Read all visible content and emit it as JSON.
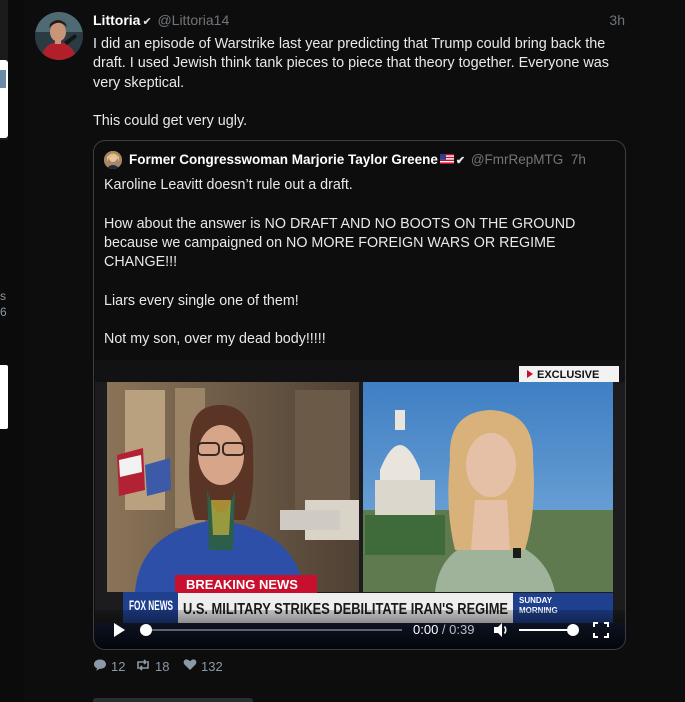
{
  "sidebar": {
    "trend_fragment_line1": "s",
    "trend_fragment_line2": "6"
  },
  "tweet": {
    "author_name": "Littoria",
    "author_handle": "@Littoria14",
    "time_ago": "3h",
    "paragraphs": [
      "I did an episode of Warstrike last year predicting that Trump could bring back the draft. I used Jewish think tank pieces to piece that theory together. Everyone was very skeptical.",
      "This could get very ugly."
    ],
    "stats": {
      "replies": "12",
      "retweets": "18",
      "likes": "132"
    }
  },
  "quoted_tweet": {
    "author_name": "Former Congresswoman Marjorie Taylor Greene",
    "author_handle": "@FmrRepMTG",
    "time_ago": "7h",
    "paragraphs": [
      "Karoline Leavitt doesn’t rule out a draft.",
      "How about the answer is NO DRAFT AND NO BOOTS ON THE GROUND because we campaigned on NO MORE FOREIGN WARS OR REGIME CHANGE!!!",
      "Liars every single one of them!",
      "Not my son, over my dead body!!!!!"
    ]
  },
  "video": {
    "exclusive_label": "EXCLUSIVE",
    "breaking_label": "BREAKING NEWS",
    "headline": "U.S. MILITARY STRIKES DEBILITATE IRAN'S REGIME",
    "network_logo": "FOX NEWS",
    "show_label_line1": "SUNDAY",
    "show_label_line2": "MORNING",
    "current_time": "0:00",
    "duration": "0:39",
    "progress": 0,
    "volume": 1.0
  },
  "icons": {
    "play": "play-icon",
    "volume": "volume-icon",
    "fullscreen": "fullscreen-icon",
    "reply": "reply-icon",
    "retweet": "retweet-icon",
    "like": "heart-icon",
    "verified": "verified-check-icon",
    "flag": "us-flag-icon"
  },
  "colors": {
    "background": "#000000",
    "panel": "#0d0d0d",
    "text": "#e7e9ea",
    "muted": "#71767b",
    "card_border": "#3b3f44",
    "breaking_red": "#c8102e",
    "fox_blue": "#1f3f8f"
  }
}
